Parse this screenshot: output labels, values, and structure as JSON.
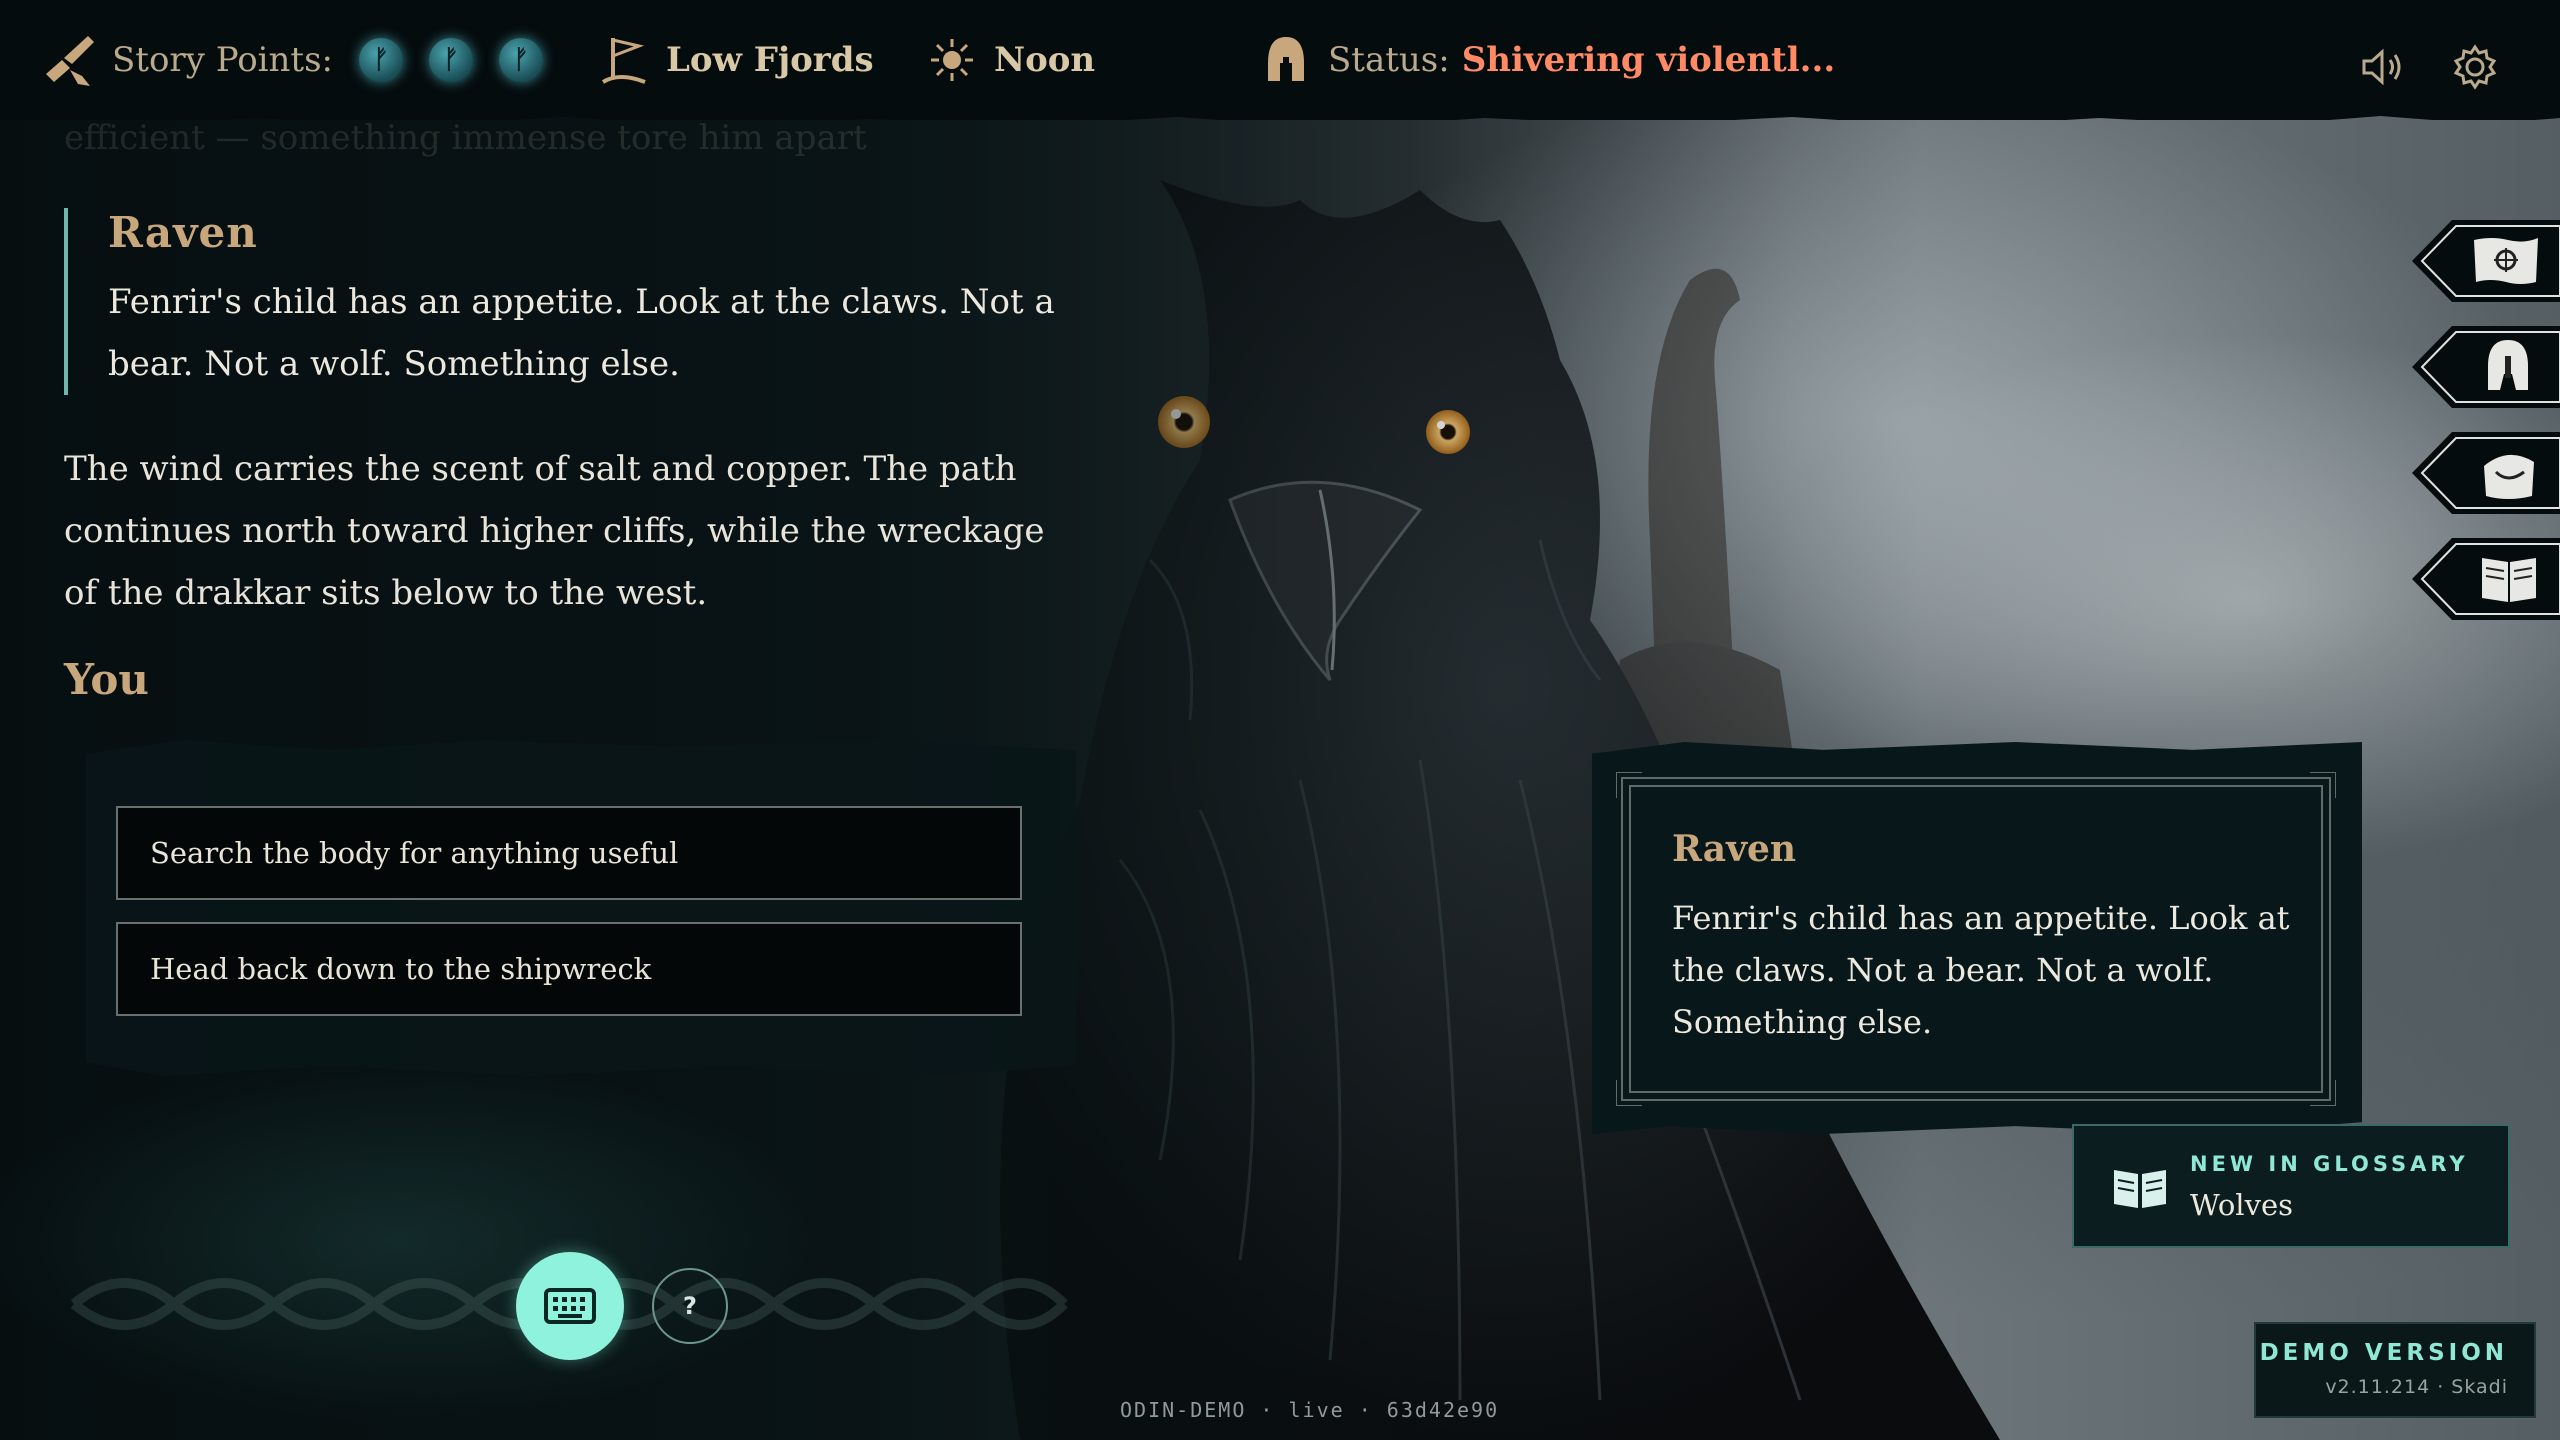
{
  "topbar": {
    "story_points_label": "Story Points:",
    "story_points": [
      "ᚠ",
      "ᚠ",
      "ᚠ"
    ],
    "location": "Low Fjords",
    "time": "Noon",
    "status_label": "Status:",
    "status_value": "Shivering violentl..."
  },
  "story": {
    "faded_line": "efficient — something immense tore him apart",
    "quote": {
      "speaker": "Raven",
      "text": "Fenrir's child has an appetite. Look at the claws. Not a bear. Not a wolf. Something else."
    },
    "narration": "The wind carries the scent of salt and copper. The path continues north toward higher cliffs, while the wreckage of the drakkar sits below to the west.",
    "you_label": "You"
  },
  "choices": [
    "Search the body for anything useful",
    "Head back down to the shipwreck"
  ],
  "controls": {
    "help_label": "?"
  },
  "speech_card": {
    "speaker": "Raven",
    "text": "Fenrir's child has an appetite. Look at the claws. Not a bear. Not a wolf. Something else."
  },
  "side_tabs": [
    "map-icon",
    "helmet-icon",
    "bag-icon",
    "book-icon"
  ],
  "glossary_toast": {
    "title": "NEW IN GLOSSARY",
    "value": "Wolves"
  },
  "demo_badge": {
    "title": "DEMO VERSION",
    "version": "v2.11.214 · Skadi"
  },
  "build": "ODIN-DEMO · live · 63d42e90",
  "colors": {
    "accent": "#8ef2dc",
    "speaker": "#c9a77c",
    "status": "#ff8a63",
    "topbar": "#050c0e"
  }
}
